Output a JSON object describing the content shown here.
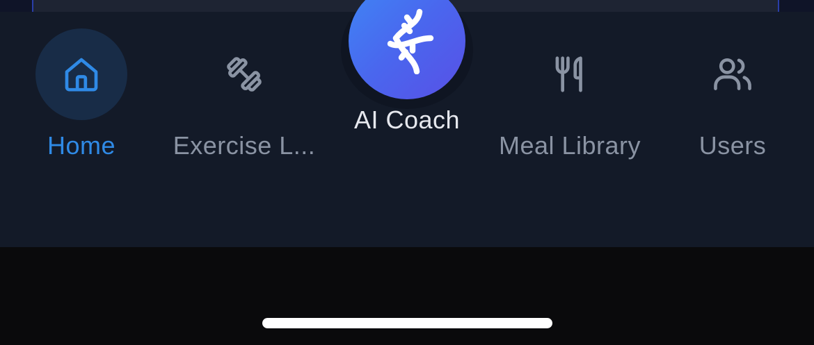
{
  "tab_bar": {
    "tabs": [
      {
        "id": "home",
        "label": "Home",
        "icon": "home-icon",
        "active": true
      },
      {
        "id": "exercise",
        "label": "Exercise L...",
        "icon": "dumbbell-icon",
        "active": false
      },
      {
        "id": "meal",
        "label": "Meal Library",
        "icon": "fork-knife-icon",
        "active": false
      },
      {
        "id": "users",
        "label": "Users",
        "icon": "users-icon",
        "active": false
      }
    ],
    "center_action": {
      "label": "AI Coach",
      "icon": "dna-icon"
    }
  },
  "colors": {
    "active": "#2f8ae6",
    "inactive": "#8a93a3",
    "tab_bar_bg": "#131a28",
    "coach_gradient_start": "#3f86f5",
    "coach_gradient_end": "#5850e6"
  }
}
